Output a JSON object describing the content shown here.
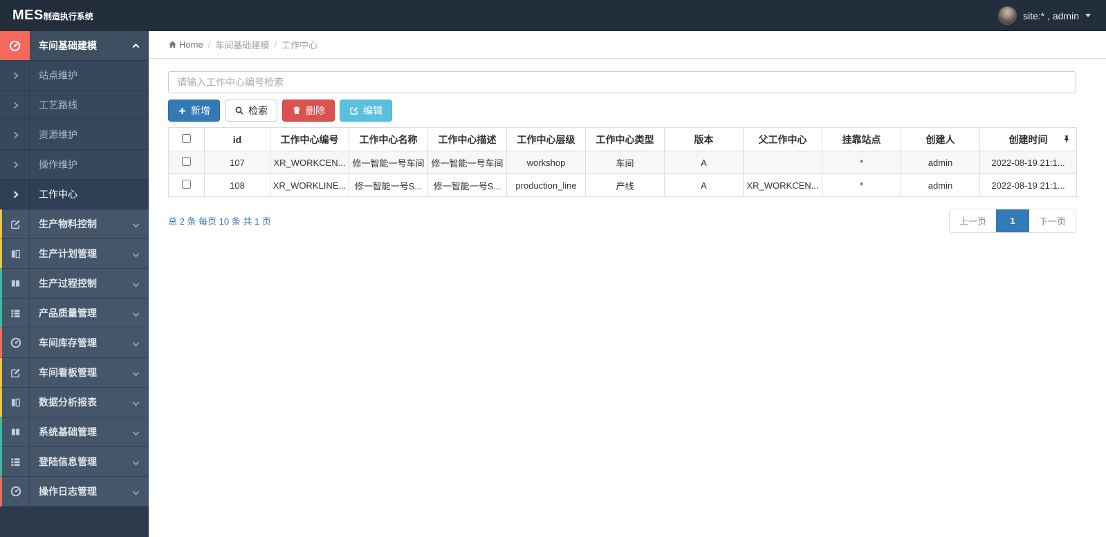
{
  "navbar": {
    "brand_bold": "MES",
    "brand_rest": "制造执行系统",
    "user_label": "site:* , admin"
  },
  "breadcrumb": {
    "home": "Home",
    "level1": "车间基础建模",
    "level2": "工作中心"
  },
  "sidebar": {
    "group_open": {
      "label": "车间基础建模",
      "icon": "gauge-icon",
      "icon_bg": "#f4695c"
    },
    "submenu": [
      {
        "label": "站点维护"
      },
      {
        "label": "工艺路线"
      },
      {
        "label": "资源维护"
      },
      {
        "label": "操作维护"
      },
      {
        "label": "工作中心",
        "active": true
      }
    ],
    "groups": [
      {
        "label": "生产物料控制",
        "icon": "pencil-icon",
        "accent": "#e9c64e"
      },
      {
        "label": "生产计划管理",
        "icon": "columns-icon",
        "accent": "#e9c64e"
      },
      {
        "label": "生产过程控制",
        "icon": "book-icon",
        "accent": "#43b8a2"
      },
      {
        "label": "产品质量管理",
        "icon": "list-icon",
        "accent": "#43b8a2"
      },
      {
        "label": "车间库存管理",
        "icon": "gauge-icon",
        "accent": "#ef6e62"
      },
      {
        "label": "车间看板管理",
        "icon": "pencil-icon",
        "accent": "#e9c64e"
      },
      {
        "label": "数据分析报表",
        "icon": "columns-icon",
        "accent": "#e9c64e"
      },
      {
        "label": "系统基础管理",
        "icon": "book-icon",
        "accent": "#43b8a2"
      },
      {
        "label": "登陆信息管理",
        "icon": "list-icon",
        "accent": "#43b8a2"
      },
      {
        "label": "操作日志管理",
        "icon": "gauge-icon",
        "accent": "#ef6e62"
      }
    ]
  },
  "search": {
    "placeholder": "请输入工作中心编号检索",
    "value": ""
  },
  "toolbar": {
    "add_label": "新增",
    "search_label": "检索",
    "delete_label": "删除",
    "edit_label": "编辑"
  },
  "table": {
    "columns": [
      "id",
      "工作中心编号",
      "工作中心名称",
      "工作中心描述",
      "工作中心层级",
      "工作中心类型",
      "版本",
      "父工作中心",
      "挂靠站点",
      "创建人",
      "创建时间"
    ],
    "rows": [
      {
        "cells": [
          "107",
          "XR_WORKCEN...",
          "修一智能一号车间",
          "修一智能一号车间",
          "workshop",
          "车间",
          "A",
          "",
          "*",
          "admin",
          "2022-08-19 21:1..."
        ]
      },
      {
        "cells": [
          "108",
          "XR_WORKLINE...",
          "修一智能一号S...",
          "修一智能一号S...",
          "production_line",
          "产线",
          "A",
          "XR_WORKCEN...",
          "*",
          "admin",
          "2022-08-19 21:1..."
        ]
      }
    ]
  },
  "pagination": {
    "summary": "总 2 条 每页 10 条 共 1 页",
    "prev_label": "上一页",
    "current_page": "1",
    "next_label": "下一页"
  },
  "colors": {
    "navbar_bg": "#232e3c",
    "sidebar_bg": "#2c3a4c",
    "open_group_icon_bg": "#f4695c",
    "primary": "#337ab7",
    "danger": "#d9534f",
    "info": "#5bc0de",
    "pager_active": "#337ab7"
  }
}
